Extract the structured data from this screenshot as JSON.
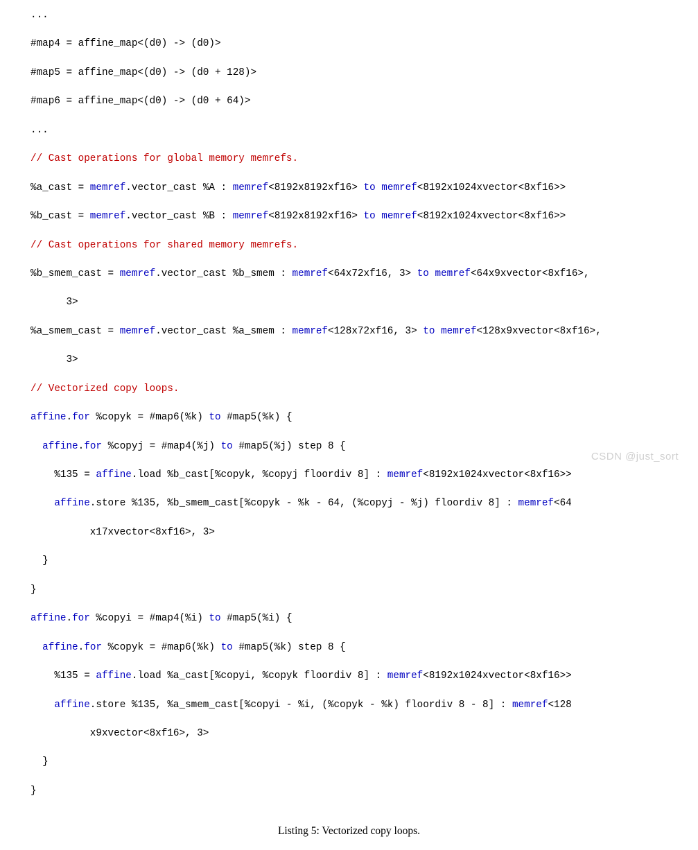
{
  "listing": {
    "caption_prefix": "Listing 5: ",
    "caption_text": "Vectorized copy loops."
  },
  "c": {
    "l1": "...",
    "l2a": "#map4 = affine_map<(d0) -> (d0)>",
    "l3a": "#map5 = affine_map<(d0) -> (d0 + 128)>",
    "l4a": "#map6 = affine_map<(d0) -> (d0 + 64)>",
    "l5": "...",
    "l6": "// Cast operations for global memory memrefs.",
    "l7a": "%a_cast = ",
    "l7b": "memref",
    "l7c": ".vector_cast %A : ",
    "l7d": "memref",
    "l7e": "<8192x8192xf16> ",
    "l7f": "to",
    "l7g": " ",
    "l7h": "memref",
    "l7i": "<8192x1024xvector<8xf16>>",
    "l8a": "%b_cast = ",
    "l8b": "memref",
    "l8c": ".vector_cast %B : ",
    "l8d": "memref",
    "l8e": "<8192x8192xf16> ",
    "l8f": "to",
    "l8g": " ",
    "l8h": "memref",
    "l8i": "<8192x1024xvector<8xf16>>",
    "l9": "// Cast operations for shared memory memrefs.",
    "l10a": "%b_smem_cast = ",
    "l10b": "memref",
    "l10c": ".vector_cast %b_smem : ",
    "l10d": "memref",
    "l10e": "<64x72xf16, 3> ",
    "l10f": "to",
    "l10g": " ",
    "l10h": "memref",
    "l10i": "<64x9xvector<8xf16>,",
    "l10j": "3>",
    "l11a": "%a_smem_cast = ",
    "l11b": "memref",
    "l11c": ".vector_cast %a_smem : ",
    "l11d": "memref",
    "l11e": "<128x72xf16, 3> ",
    "l11f": "to",
    "l11g": " ",
    "l11h": "memref",
    "l11i": "<128x9xvector<8xf16>,",
    "l11j": "3>",
    "l12": "// Vectorized copy loops.",
    "l13a": "affine",
    "l13b": ".",
    "l13c": "for",
    "l13d": " %copyk = #map6(%k) ",
    "l13e": "to",
    "l13f": " #map5(%k) {",
    "l14a": "affine",
    "l14b": ".",
    "l14c": "for",
    "l14d": " %copyj = #map4(%j) ",
    "l14e": "to",
    "l14f": " #map5(%j) step 8 {",
    "l15a": "%135 = ",
    "l15b": "affine",
    "l15c": ".load %b_cast[%copyk, %copyj floordiv 8] : ",
    "l15d": "memref",
    "l15e": "<8192x1024xvector<8xf16>>",
    "l16a": "affine",
    "l16b": ".store %135, %b_smem_cast[%copyk - %k - 64, (%copyj - %j) floordiv 8] : ",
    "l16c": "memref",
    "l16d": "<64",
    "l16e": "x17xvector<8xf16>, 3>",
    "l17": "}",
    "l18": "}",
    "l19a": "affine",
    "l19b": ".",
    "l19c": "for",
    "l19d": " %copyi = #map4(%i) ",
    "l19e": "to",
    "l19f": " #map5(%i) {",
    "l20a": "affine",
    "l20b": ".",
    "l20c": "for",
    "l20d": " %copyk = #map6(%k) ",
    "l20e": "to",
    "l20f": " #map5(%k) step 8 {",
    "l21a": "%135 = ",
    "l21b": "affine",
    "l21c": ".load %a_cast[%copyi, %copyk floordiv 8] : ",
    "l21d": "memref",
    "l21e": "<8192x1024xvector<8xf16>>",
    "l22a": "affine",
    "l22b": ".store %135, %a_smem_cast[%copyi - %i, (%copyk - %k) floordiv 8 - 8] : ",
    "l22c": "memref",
    "l22d": "<128",
    "l22e": "x9xvector<8xf16>, 3>",
    "l23": "}",
    "l24": "}"
  },
  "watermark": "CSDN @just_sort"
}
